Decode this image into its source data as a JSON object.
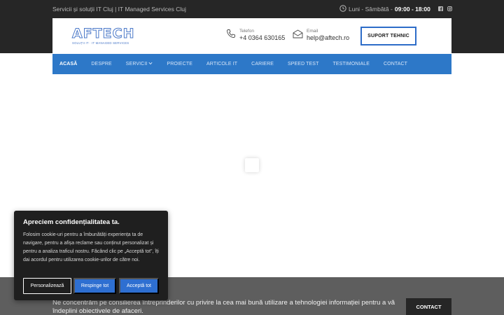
{
  "topbar": {
    "tagline": "Servicii și soluții IT Cluj | IT Managed Services Cluj",
    "hours_days": "Luni - Sâmbătă - ",
    "hours_time": "09:00 - 18:00"
  },
  "header": {
    "logo_text": "AFTECH",
    "logo_subtext": "SOLUȚII IT · IT MANAGED SERVICES",
    "phone_label": "Telefon",
    "phone_value": "+4 0364 630165",
    "email_label": "Email",
    "email_value": "help@aftech.ro",
    "support_button": "SUPORT TEHNIC"
  },
  "nav": {
    "items": [
      {
        "label": "ACASĂ"
      },
      {
        "label": "DESPRE"
      },
      {
        "label": "SERVICII"
      },
      {
        "label": "PROIECTE"
      },
      {
        "label": "ARTICOLE IT"
      },
      {
        "label": "CARIERE"
      },
      {
        "label": "SPEED TEST"
      },
      {
        "label": "TESTIMONIALE"
      },
      {
        "label": "CONTACT"
      }
    ]
  },
  "footer_bar": {
    "text": "Ne concentrăm pe consilierea întreprinderilor cu privire la cea mai bună utilizare a tehnologiei informației pentru a vă îndeplini obiectivele de afaceri.",
    "contact_button": "CONTACT"
  },
  "cookie": {
    "title": "Apreciem confidențialitatea ta.",
    "body": "Folosim cookie-uri pentru a îmbunătăți experiența ta de navigare, pentru a afișa reclame sau conținut personalizat și pentru a analiza traficul nostru. Făcând clic pe „Acceptă tot”, îți dai acordul pentru utilizarea cookie-urilor de către noi.",
    "customize": "Personalizează",
    "reject": "Respinge tot",
    "accept": "Acceptă tot"
  },
  "colors": {
    "accent": "#2d78c8",
    "dark": "#262626",
    "cookie_button": "#2e6fd1"
  },
  "icons": [
    "clock-icon",
    "facebook-icon",
    "instagram-icon",
    "phone-icon",
    "envelope-icon",
    "chevron-down-icon"
  ]
}
